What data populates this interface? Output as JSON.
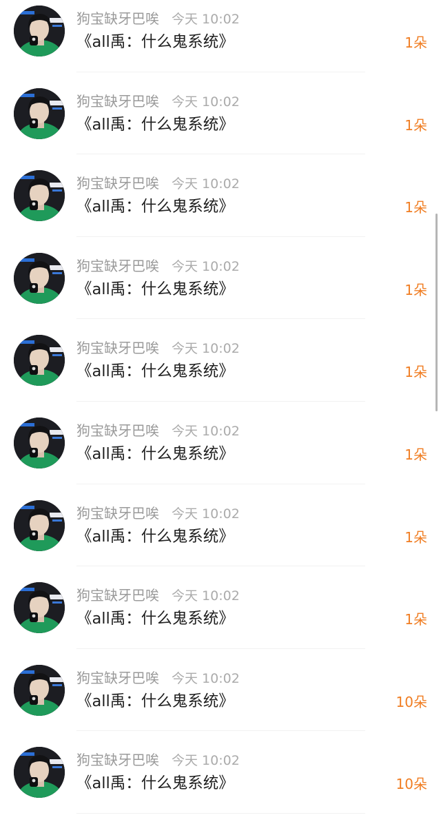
{
  "messages": [
    {
      "sender": "狗宝缺牙巴唉",
      "time": "今天 10:02",
      "title": "《all禹：什么鬼系统》",
      "amount": "1朵"
    },
    {
      "sender": "狗宝缺牙巴唉",
      "time": "今天 10:02",
      "title": "《all禹：什么鬼系统》",
      "amount": "1朵"
    },
    {
      "sender": "狗宝缺牙巴唉",
      "time": "今天 10:02",
      "title": "《all禹：什么鬼系统》",
      "amount": "1朵"
    },
    {
      "sender": "狗宝缺牙巴唉",
      "time": "今天 10:02",
      "title": "《all禹：什么鬼系统》",
      "amount": "1朵"
    },
    {
      "sender": "狗宝缺牙巴唉",
      "time": "今天 10:02",
      "title": "《all禹：什么鬼系统》",
      "amount": "1朵"
    },
    {
      "sender": "狗宝缺牙巴唉",
      "time": "今天 10:02",
      "title": "《all禹：什么鬼系统》",
      "amount": "1朵"
    },
    {
      "sender": "狗宝缺牙巴唉",
      "time": "今天 10:02",
      "title": "《all禹：什么鬼系统》",
      "amount": "1朵"
    },
    {
      "sender": "狗宝缺牙巴唉",
      "time": "今天 10:02",
      "title": "《all禹：什么鬼系统》",
      "amount": "1朵"
    },
    {
      "sender": "狗宝缺牙巴唉",
      "time": "今天 10:02",
      "title": "《all禹：什么鬼系统》",
      "amount": "10朵"
    },
    {
      "sender": "狗宝缺牙巴唉",
      "time": "今天 10:02",
      "title": "《all禹：什么鬼系统》",
      "amount": "10朵"
    }
  ],
  "colors": {
    "amount": "#f07d22",
    "sender": "#9a9a9a",
    "title": "#1f1f1f",
    "avatar_shirt": "#1f9a5a",
    "avatar_bg": "#1c1d22"
  },
  "icons": {
    "avatar": "avatar-photo"
  }
}
